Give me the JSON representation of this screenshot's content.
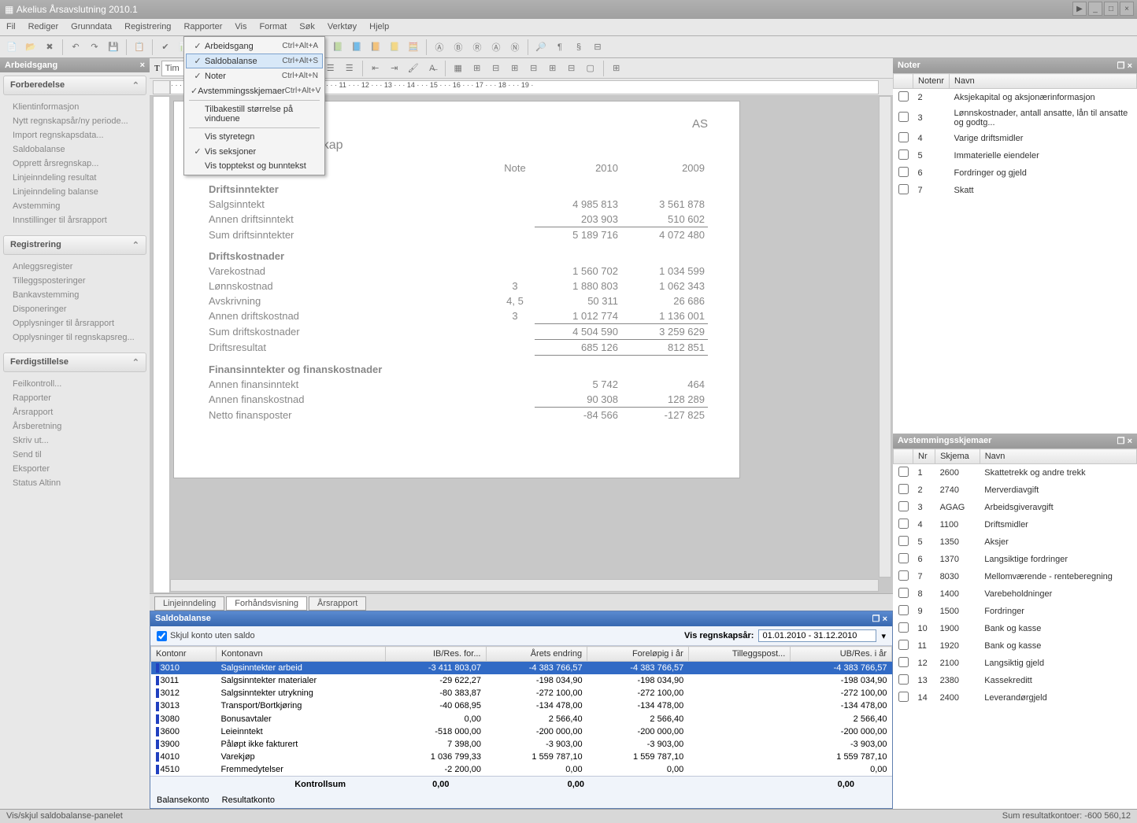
{
  "window": {
    "title": "Akelius Årsavslutning 2010.1"
  },
  "menubar": [
    "Fil",
    "Rediger",
    "Grunndata",
    "Registrering",
    "Rapporter",
    "Vis",
    "Format",
    "Søk",
    "Verktøy",
    "Hjelp"
  ],
  "dropdown": {
    "items": [
      {
        "checked": true,
        "label": "Arbeidsgang",
        "shortcut": "Ctrl+Alt+A",
        "hl": false
      },
      {
        "checked": true,
        "label": "Saldobalanse",
        "shortcut": "Ctrl+Alt+S",
        "hl": true
      },
      {
        "checked": true,
        "label": "Noter",
        "shortcut": "Ctrl+Alt+N",
        "hl": false
      },
      {
        "checked": true,
        "label": "Avstemmingsskjemaer",
        "shortcut": "Ctrl+Alt+V",
        "hl": false
      }
    ],
    "items2": [
      {
        "label": "Tilbakestill størrelse på vinduene"
      }
    ],
    "items3": [
      {
        "checked": false,
        "label": "Vis styretegn"
      },
      {
        "checked": true,
        "label": "Vis seksjoner"
      },
      {
        "checked": false,
        "label": "Vis topptekst og bunntekst"
      }
    ]
  },
  "left": {
    "title": "Arbeidsgang",
    "sections": [
      {
        "title": "Forberedelse",
        "items": [
          "Klientinformasjon",
          "Nytt regnskapsår/ny periode...",
          "Import regnskapsdata...",
          "Saldobalanse",
          "Opprett årsregnskap...",
          "Linjeinndeling resultat",
          "Linjeinndeling balanse",
          "Avstemming",
          "Innstillinger til årsrapport"
        ]
      },
      {
        "title": "Registrering",
        "items": [
          "Anleggsregister",
          "Tilleggsposteringer",
          "Bankavstemming",
          "Disponeringer",
          "Opplysninger til årsrapport",
          "Opplysninger til regnskapsreg..."
        ]
      },
      {
        "title": "Ferdigstillelse",
        "items": [
          "Feilkontroll...",
          "Rapporter",
          "Årsrapport",
          "Årsberetning",
          "Skriv ut...",
          "Send til",
          "Eksporter",
          "Status Altinn"
        ]
      }
    ]
  },
  "format": {
    "font": "Tim"
  },
  "ruler": "· · · 3 · · · 4 · · · 5 · · · 6 · · · 7 · · · 8 · · · 9 · · · 10 · · · 11 · · · 12 · · · 13 · · · 14 · · · 15 · · · 16 · · · 17 · · · 18 · · · 19 ·",
  "doc": {
    "company_suffix": "AS",
    "title": "Resultatregnskap",
    "col_note": "Note",
    "col_y1": "2010",
    "col_y2": "2009",
    "groups": [
      {
        "head": "Driftsinntekter",
        "rows": [
          {
            "label": "Salgsinntekt",
            "note": "",
            "y1": "4 985 813",
            "y2": "3 561 878"
          },
          {
            "label": "Annen driftsinntekt",
            "note": "",
            "y1": "203 903",
            "y2": "510 602",
            "lineb": true
          },
          {
            "label": "Sum driftsinntekter",
            "note": "",
            "y1": "5 189 716",
            "y2": "4 072 480",
            "line": true
          }
        ]
      },
      {
        "head": "Driftskostnader",
        "rows": [
          {
            "label": "Varekostnad",
            "note": "",
            "y1": "1 560 702",
            "y2": "1 034 599"
          },
          {
            "label": "Lønnskostnad",
            "note": "3",
            "y1": "1 880 803",
            "y2": "1 062 343"
          },
          {
            "label": "Avskrivning",
            "note": "4, 5",
            "y1": "50 311",
            "y2": "26 686"
          },
          {
            "label": "Annen driftskostnad",
            "note": "3",
            "y1": "1 012 774",
            "y2": "1 136 001",
            "lineb": true
          },
          {
            "label": "Sum driftskostnader",
            "note": "",
            "y1": "4 504 590",
            "y2": "3 259 629",
            "line": true
          }
        ]
      },
      {
        "head": "",
        "rows": [
          {
            "label": "Driftsresultat",
            "note": "",
            "y1": "685 126",
            "y2": "812 851",
            "line": true,
            "lineb": true
          }
        ]
      },
      {
        "head": "Finansinntekter og finanskostnader",
        "rows": [
          {
            "label": "Annen finansinntekt",
            "note": "",
            "y1": "5 742",
            "y2": "464"
          },
          {
            "label": "Annen finanskostnad",
            "note": "",
            "y1": "90 308",
            "y2": "128 289",
            "lineb": true
          },
          {
            "label": "Netto finansposter",
            "note": "",
            "y1": "-84 566",
            "y2": "-127 825",
            "line": true
          }
        ]
      }
    ]
  },
  "tabs": [
    "Linjeinndeling",
    "Forhåndsvisning",
    "Årsrapport"
  ],
  "saldo": {
    "title": "Saldobalanse",
    "hide_label": "Skjul konto uten saldo",
    "hide_checked": true,
    "period_label": "Vis regnskapsår:",
    "period_value": "01.01.2010 - 31.12.2010",
    "cols": [
      "Kontonr",
      "Kontonavn",
      "IB/Res. for...",
      "Årets endring",
      "Foreløpig i år",
      "Tilleggspost...",
      "UB/Res. i år"
    ],
    "rows": [
      {
        "bar": "b",
        "nr": "3010",
        "navn": "Salgsinntekter arbeid",
        "ib": "-3 411 803,07",
        "end": "-4 383 766,57",
        "for": "-4 383 766,57",
        "til": "",
        "ub": "-4 383 766,57",
        "sel": true
      },
      {
        "bar": "b",
        "nr": "3011",
        "navn": "Salgsinntekter materialer",
        "ib": "-29 622,27",
        "end": "-198 034,90",
        "for": "-198 034,90",
        "til": "",
        "ub": "-198 034,90"
      },
      {
        "bar": "b",
        "nr": "3012",
        "navn": "Salgsinntekter utrykning",
        "ib": "-80 383,87",
        "end": "-272 100,00",
        "for": "-272 100,00",
        "til": "",
        "ub": "-272 100,00"
      },
      {
        "bar": "b",
        "nr": "3013",
        "navn": "Transport/Bortkjøring",
        "ib": "-40 068,95",
        "end": "-134 478,00",
        "for": "-134 478,00",
        "til": "",
        "ub": "-134 478,00"
      },
      {
        "bar": "b",
        "nr": "3080",
        "navn": "Bonusavtaler",
        "ib": "0,00",
        "end": "2 566,40",
        "for": "2 566,40",
        "til": "",
        "ub": "2 566,40"
      },
      {
        "bar": "b",
        "nr": "3600",
        "navn": "Leieinntekt",
        "ib": "-518 000,00",
        "end": "-200 000,00",
        "for": "-200 000,00",
        "til": "",
        "ub": "-200 000,00"
      },
      {
        "bar": "b",
        "nr": "3900",
        "navn": "Påløpt ikke fakturert",
        "ib": "7 398,00",
        "end": "-3 903,00",
        "for": "-3 903,00",
        "til": "",
        "ub": "-3 903,00"
      },
      {
        "bar": "b",
        "nr": "4010",
        "navn": "Varekjøp",
        "ib": "1 036 799,33",
        "end": "1 559 787,10",
        "for": "1 559 787,10",
        "til": "",
        "ub": "1 559 787,10"
      },
      {
        "bar": "b",
        "nr": "4510",
        "navn": "Fremmedytelser",
        "ib": "-2 200,00",
        "end": "0,00",
        "for": "0,00",
        "til": "",
        "ub": "0,00"
      }
    ],
    "sum_label": "Kontrollsum",
    "sum_ib": "0,00",
    "sum_for": "0,00",
    "sum_ub": "0,00",
    "legend_balance": "Balansekonto",
    "legend_result": "Resultatkonto"
  },
  "noter": {
    "title": "Noter",
    "cols": [
      "Notenr",
      "Navn"
    ],
    "rows": [
      {
        "nr": "2",
        "navn": "Aksjekapital og aksjonærinformasjon"
      },
      {
        "nr": "3",
        "navn": "Lønnskostnader, antall ansatte, lån til ansatte og godtg..."
      },
      {
        "nr": "4",
        "navn": "Varige driftsmidler"
      },
      {
        "nr": "5",
        "navn": "Immaterielle eiendeler"
      },
      {
        "nr": "6",
        "navn": "Fordringer og gjeld"
      },
      {
        "nr": "7",
        "navn": "Skatt"
      }
    ]
  },
  "avst": {
    "title": "Avstemmingsskjemaer",
    "cols": [
      "Nr",
      "Skjema",
      "Navn"
    ],
    "rows": [
      {
        "nr": "1",
        "sk": "2600",
        "navn": "Skattetrekk og andre trekk"
      },
      {
        "nr": "2",
        "sk": "2740",
        "navn": "Merverdiavgift"
      },
      {
        "nr": "3",
        "sk": "AGAG",
        "navn": "Arbeidsgiveravgift"
      },
      {
        "nr": "4",
        "sk": "1100",
        "navn": "Driftsmidler"
      },
      {
        "nr": "5",
        "sk": "1350",
        "navn": "Aksjer"
      },
      {
        "nr": "6",
        "sk": "1370",
        "navn": "Langsiktige fordringer"
      },
      {
        "nr": "7",
        "sk": "8030",
        "navn": "Mellomværende - renteberegning"
      },
      {
        "nr": "8",
        "sk": "1400",
        "navn": "Varebeholdninger"
      },
      {
        "nr": "9",
        "sk": "1500",
        "navn": "Fordringer"
      },
      {
        "nr": "10",
        "sk": "1900",
        "navn": "Bank og kasse"
      },
      {
        "nr": "11",
        "sk": "1920",
        "navn": "Bank og kasse"
      },
      {
        "nr": "12",
        "sk": "2100",
        "navn": "Langsiktig gjeld"
      },
      {
        "nr": "13",
        "sk": "2380",
        "navn": "Kassekreditt"
      },
      {
        "nr": "14",
        "sk": "2400",
        "navn": "Leverandørgjeld"
      }
    ]
  },
  "status": {
    "left": "Vis/skjul saldobalanse-panelet",
    "right": "Sum resultatkontoer: -600 560,12"
  }
}
